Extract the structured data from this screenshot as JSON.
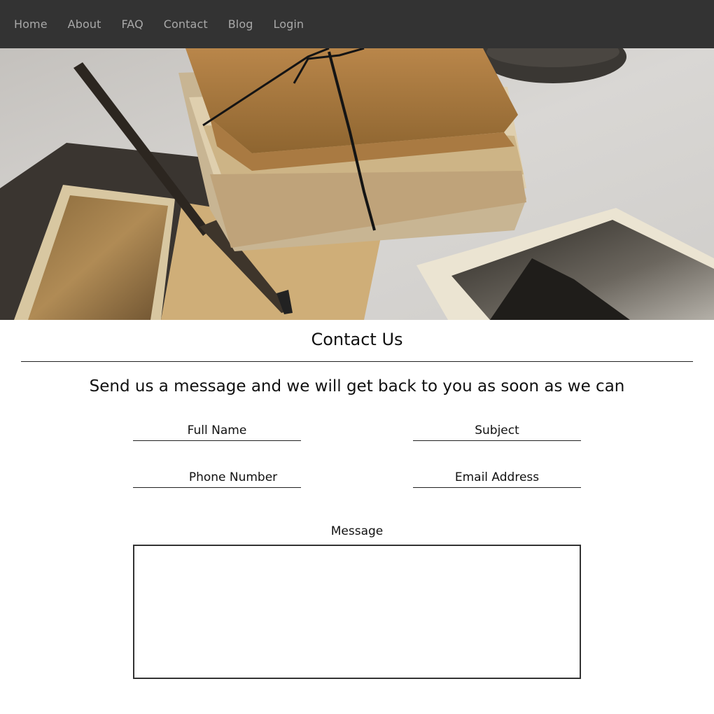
{
  "nav": {
    "items": [
      {
        "label": "Home"
      },
      {
        "label": "About"
      },
      {
        "label": "FAQ"
      },
      {
        "label": "Contact"
      },
      {
        "label": "Blog"
      },
      {
        "label": "Login"
      }
    ],
    "background": "#333333",
    "text_color": "#a8a8a8"
  },
  "hero": {
    "image": "vintage-letters-and-photos"
  },
  "contact": {
    "title": "Contact Us",
    "subtitle": "Send us a message and we will get back to you as soon as we can",
    "fields": {
      "full_name": {
        "placeholder": "Full Name",
        "value": ""
      },
      "subject": {
        "placeholder": "Subject",
        "value": ""
      },
      "phone": {
        "placeholder": "Phone Number",
        "value": ""
      },
      "email": {
        "placeholder": "Email Address",
        "value": ""
      }
    },
    "message_label": "Message",
    "message_value": ""
  }
}
